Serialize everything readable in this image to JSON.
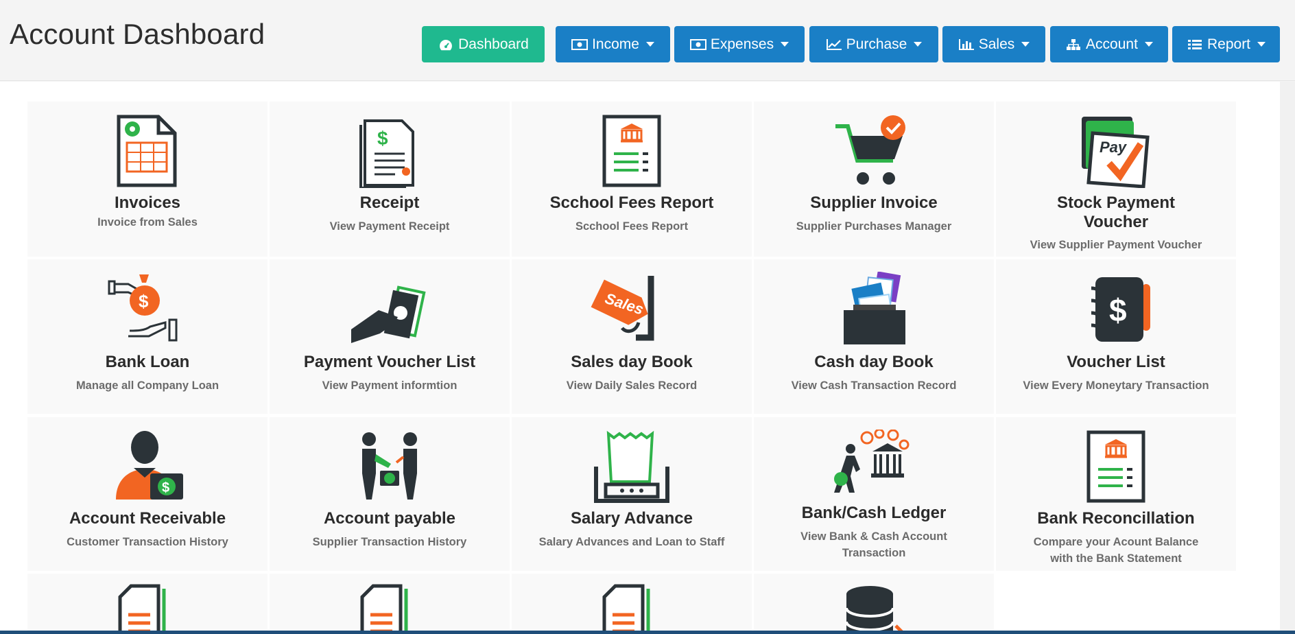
{
  "header": {
    "title": "Account Dashboard"
  },
  "nav": [
    {
      "label": "Dashboard",
      "icon": "tachometer-icon",
      "dropdown": false
    },
    {
      "label": "Income",
      "icon": "money-icon",
      "dropdown": true
    },
    {
      "label": "Expenses",
      "icon": "money-icon",
      "dropdown": true
    },
    {
      "label": "Purchase",
      "icon": "line-chart-icon",
      "dropdown": true
    },
    {
      "label": "Sales",
      "icon": "bar-chart-icon",
      "dropdown": true
    },
    {
      "label": "Account",
      "icon": "sitemap-icon",
      "dropdown": true
    },
    {
      "label": "Report",
      "icon": "list-icon",
      "dropdown": true
    }
  ],
  "tiles": [
    {
      "title": "Invoices",
      "sub": "Invoice from Sales",
      "icon": "invoice-icon"
    },
    {
      "title": "Receipt",
      "sub": "View Payment Receipt",
      "icon": "receipt-icon"
    },
    {
      "title": "Scchool Fees Report",
      "sub": "Scchool Fees Report",
      "icon": "fees-report-icon"
    },
    {
      "title": "Supplier Invoice",
      "sub": "Supplier Purchases Manager",
      "icon": "shopping-cart-icon"
    },
    {
      "title": "Stock Payment Voucher",
      "sub": "View Supplier Payment Voucher",
      "icon": "pay-voucher-icon"
    },
    {
      "title": "Bank Loan",
      "sub": "Manage all Company Loan",
      "icon": "loan-icon"
    },
    {
      "title": "Payment Voucher List",
      "sub": "View Payment informtion",
      "icon": "cash-hand-icon"
    },
    {
      "title": "Sales day Book",
      "sub": "View Daily Sales Record",
      "icon": "sales-tag-icon"
    },
    {
      "title": "Cash day Book",
      "sub": "View Cash Transaction Record",
      "icon": "files-folder-icon"
    },
    {
      "title": "Voucher List",
      "sub": "View Every Moneytary Transaction",
      "icon": "ledger-book-icon"
    },
    {
      "title": "Account Receivable",
      "sub": "Customer Transaction History",
      "icon": "person-money-icon"
    },
    {
      "title": "Account payable",
      "sub": "Supplier Transaction History",
      "icon": "exchange-icon"
    },
    {
      "title": "Salary Advance",
      "sub": "Salary Advances and Loan to Staff",
      "icon": "receipt-printer-icon"
    },
    {
      "title": "Bank/Cash Ledger",
      "sub": "View Bank & Cash Account Transaction",
      "icon": "bank-walk-icon"
    },
    {
      "title": "Bank Reconcillation",
      "sub": "Compare your Acount Balance with the Bank Statement",
      "icon": "bank-statement-icon"
    },
    {
      "title": "",
      "sub": "",
      "icon": "document-icon"
    },
    {
      "title": "",
      "sub": "",
      "icon": "document-icon"
    },
    {
      "title": "",
      "sub": "",
      "icon": "document-icon"
    },
    {
      "title": "",
      "sub": "",
      "icon": "database-icon"
    }
  ],
  "colors": {
    "green": "#1fb98f",
    "blue": "#1a7fc6",
    "orange": "#f26522",
    "iconGreen": "#2fb34a",
    "dark": "#2b3338"
  }
}
